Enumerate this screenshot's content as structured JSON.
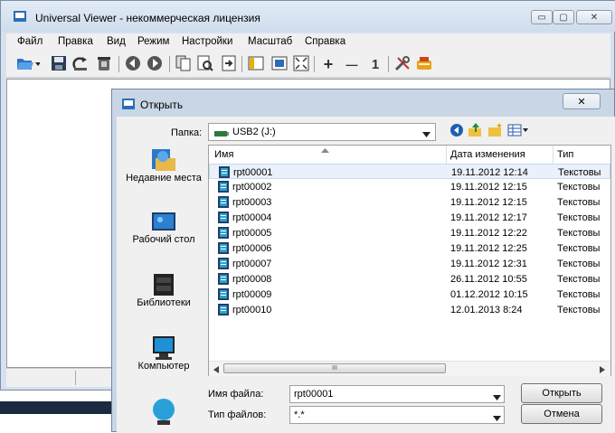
{
  "app": {
    "title": "Universal Viewer - некоммерческая лицензия",
    "window_controls": {
      "minimize": "▭",
      "maximize": "▢",
      "close": "✕"
    }
  },
  "menu": [
    "Файл",
    "Правка",
    "Вид",
    "Режим",
    "Настройки",
    "Масштаб",
    "Справка"
  ],
  "toolbar": {
    "icons": [
      "open-icon",
      "save-icon",
      "reload-icon",
      "delete-icon",
      "back-icon",
      "forward-icon",
      "copy-icon",
      "print-preview-icon",
      "export-icon",
      "panel-icon",
      "fullscreen-window-icon",
      "fit-icon",
      "zoom-in-icon",
      "zoom-out-icon",
      "actual-size-icon",
      "tools-icon",
      "plugin-icon"
    ],
    "zoom_in": "+",
    "zoom_out": "—",
    "actual_size": "1"
  },
  "dialog": {
    "title": "Открыть",
    "close": "✕",
    "folder_label": "Папка:",
    "folder_value": "USB2 (J:)",
    "places": [
      {
        "label": "Недавние места",
        "icon": "recent-places-icon"
      },
      {
        "label": "Рабочий стол",
        "icon": "desktop-icon"
      },
      {
        "label": "Библиотеки",
        "icon": "libraries-icon"
      },
      {
        "label": "Компьютер",
        "icon": "computer-icon"
      },
      {
        "label": "",
        "icon": "network-icon"
      }
    ],
    "columns": {
      "name": "Имя",
      "date": "Дата изменения",
      "type": "Тип"
    },
    "files": [
      {
        "name": "rpt00001",
        "date": "19.11.2012 12:14",
        "type": "Текстовы"
      },
      {
        "name": "rpt00002",
        "date": "19.11.2012 12:15",
        "type": "Текстовы"
      },
      {
        "name": "rpt00003",
        "date": "19.11.2012 12:15",
        "type": "Текстовы"
      },
      {
        "name": "rpt00004",
        "date": "19.11.2012 12:17",
        "type": "Текстовы"
      },
      {
        "name": "rpt00005",
        "date": "19.11.2012 12:22",
        "type": "Текстовы"
      },
      {
        "name": "rpt00006",
        "date": "19.11.2012 12:25",
        "type": "Текстовы"
      },
      {
        "name": "rpt00007",
        "date": "19.11.2012 12:31",
        "type": "Текстовы"
      },
      {
        "name": "rpt00008",
        "date": "26.11.2012 10:55",
        "type": "Текстовы"
      },
      {
        "name": "rpt00009",
        "date": "01.12.2012 10:15",
        "type": "Текстовы"
      },
      {
        "name": "rpt00010",
        "date": "12.01.2013 8:24",
        "type": "Текстовы"
      }
    ],
    "filename_label": "Имя файла:",
    "filename_value": "rpt00001",
    "filetype_label": "Тип файлов:",
    "filetype_value": "*.*",
    "open_button": "Открыть",
    "cancel_button": "Отмена",
    "scroll_grip": "III"
  }
}
